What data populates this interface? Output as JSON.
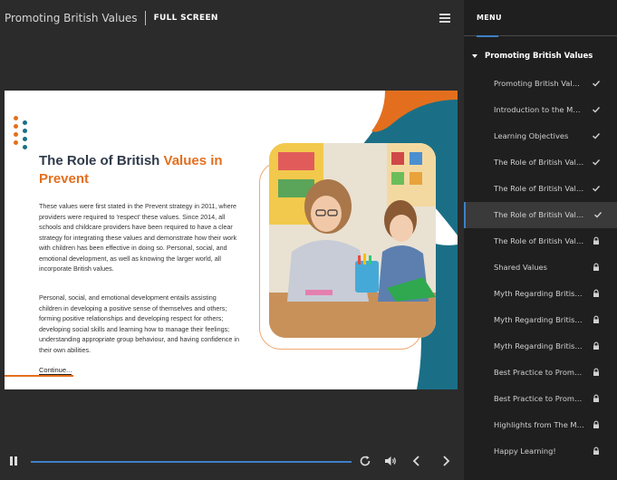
{
  "header": {
    "course_title": "Promoting British Values",
    "fullscreen_label": "FULL SCREEN"
  },
  "slide": {
    "title_main": "The Role of British ",
    "title_accent": "Values in Prevent",
    "paragraph1": "These values were first stated in the Prevent strategy in 2011, where providers were required to 'respect' these values. Since 2014, all schools and childcare providers have been required to have a clear strategy for integrating these values and demonstrate how their work with children has been effective in doing so. Personal, social, and emotional development, as well as knowing the larger world, all incorporate British values.",
    "paragraph2": "Personal, social, and emotional development entails assisting children in developing a positive sense of themselves and others; forming positive relationships and developing respect for others; developing social skills and learning how to manage their feelings; understanding appropriate group behaviour, and having confidence in their own abilities.",
    "continue_label": "Continue...",
    "colors": {
      "accent": "#e36f1e",
      "teal": "#1a6f86",
      "navy": "#2f3a4a"
    }
  },
  "playbar": {
    "progress_percent": 100
  },
  "menu": {
    "label": "MENU",
    "section_title": "Promoting British Values",
    "items": [
      {
        "label": "Promoting British Values",
        "status": "completed"
      },
      {
        "label": "Introduction to the Module",
        "status": "completed"
      },
      {
        "label": "Learning Objectives",
        "status": "completed"
      },
      {
        "label": "The Role of British Values",
        "status": "completed"
      },
      {
        "label": "The Role of British Values",
        "status": "completed"
      },
      {
        "label": "The Role of British Values",
        "status": "completed"
      },
      {
        "label": "The Role of British Values",
        "status": "locked"
      },
      {
        "label": "Shared Values",
        "status": "locked"
      },
      {
        "label": "Myth Regarding British Values",
        "status": "locked"
      },
      {
        "label": "Myth Regarding British Values",
        "status": "locked"
      },
      {
        "label": "Myth Regarding British Values",
        "status": "locked"
      },
      {
        "label": "Best Practice to Promote",
        "status": "locked"
      },
      {
        "label": "Best Practice to Promote",
        "status": "locked"
      },
      {
        "label": "Highlights from The Module",
        "status": "locked"
      },
      {
        "label": "Happy Learning!",
        "status": "locked"
      }
    ],
    "active_index": 5
  }
}
